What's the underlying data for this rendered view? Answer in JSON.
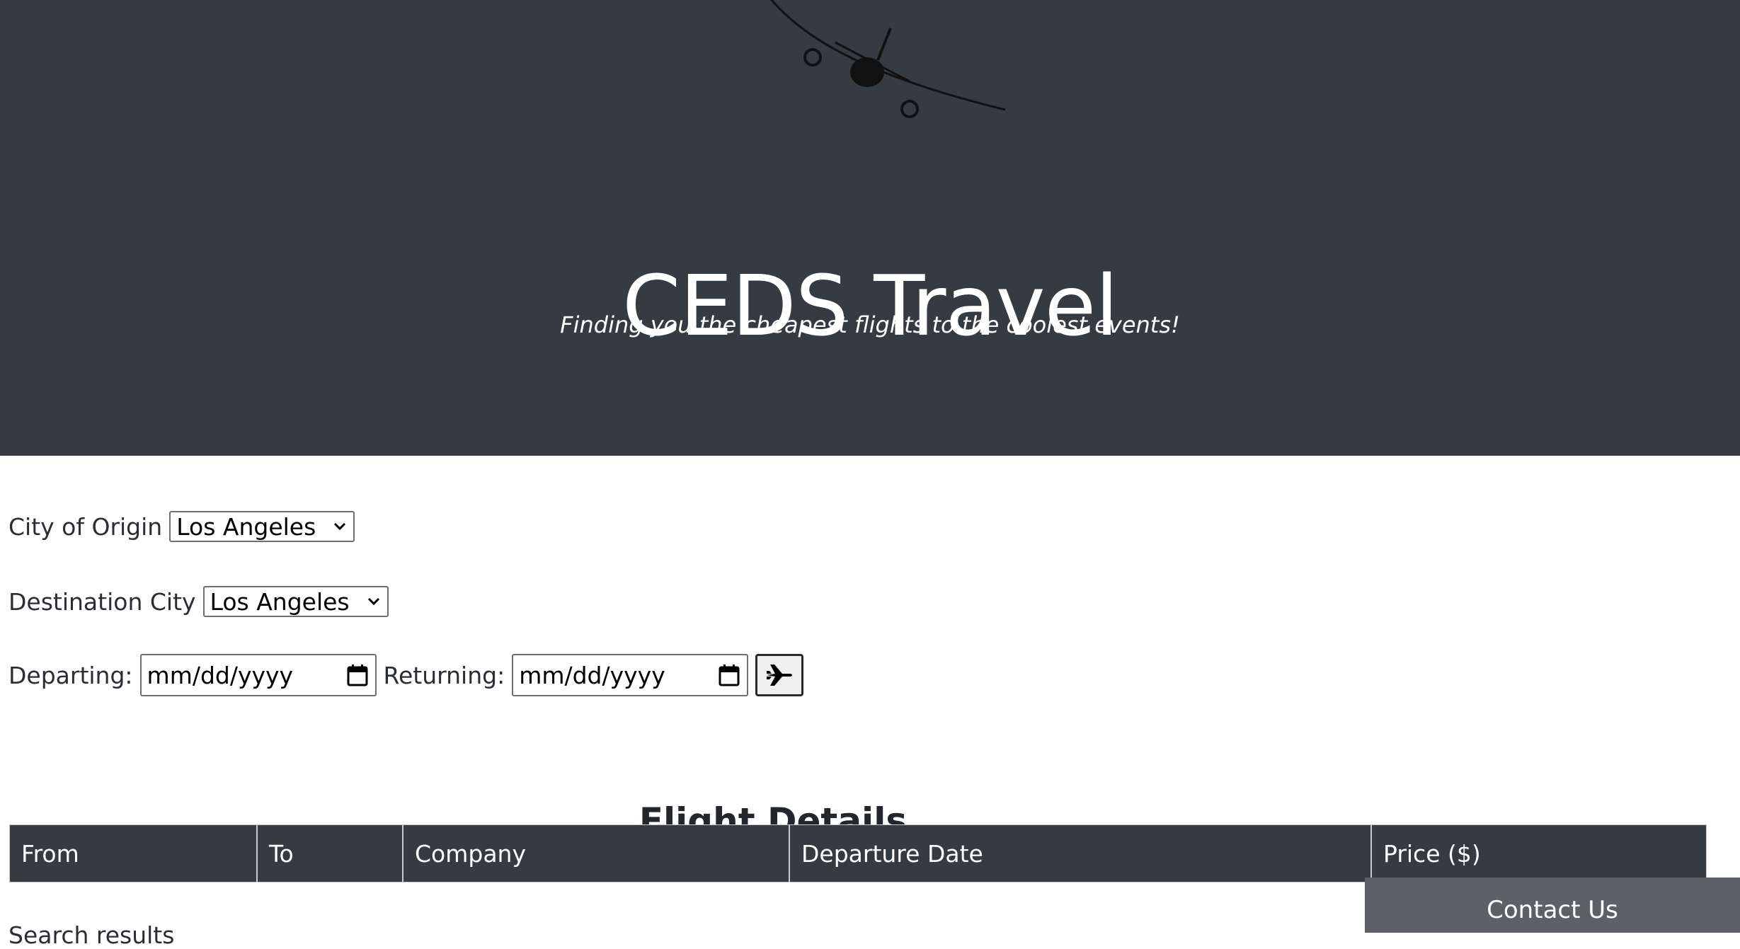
{
  "hero": {
    "logo_icon": "airplane-icon",
    "title": "CEDS Travel",
    "tagline": "Finding you the cheapest flights to the coolest events!",
    "background": "#363a41"
  },
  "search": {
    "origin_label": "City of Origin",
    "origin_value": "Los Angeles",
    "destination_label": "Destination City",
    "destination_value": "Los Angeles",
    "departing_label": "Departing:",
    "departing_placeholder": "mm/dd/yyyy",
    "returning_label": "Returning:",
    "returning_placeholder": "mm/dd/yyyy",
    "submit_icon": "airplane-icon"
  },
  "results": {
    "title": "Flight Details",
    "columns": [
      "From",
      "To",
      "Company",
      "Departure Date",
      "Price ($)"
    ]
  },
  "footer": {
    "partial_text": "Search results",
    "contact_label": "Contact Us",
    "contact_color": "#5d6166"
  }
}
